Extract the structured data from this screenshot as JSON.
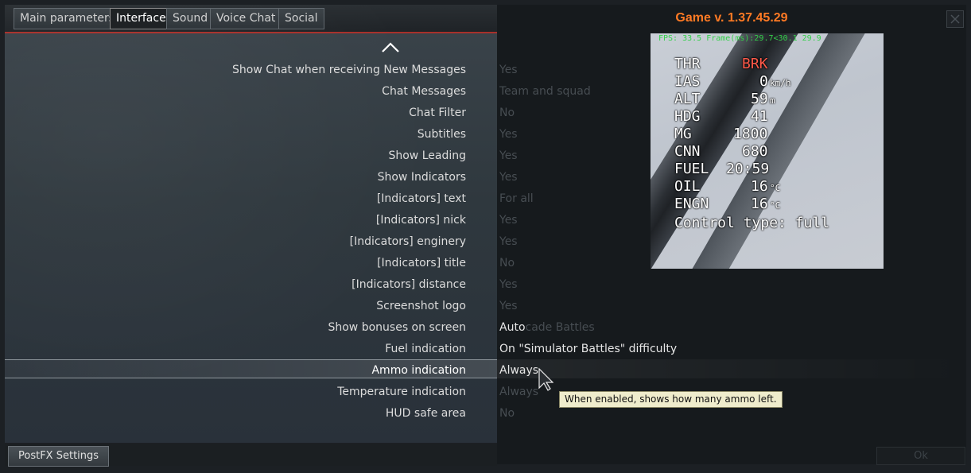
{
  "tabs": [
    {
      "label": "Main parameters"
    },
    {
      "label": "Interface"
    },
    {
      "label": "Sound"
    },
    {
      "label": "Voice Chat"
    },
    {
      "label": "Social"
    }
  ],
  "version": "Game v. 1.37.45.29",
  "settings": [
    {
      "label": "Show Chat when receiving New Messages",
      "value": "Yes"
    },
    {
      "label": "Chat Messages",
      "value": "Team and squad"
    },
    {
      "label": "Chat Filter",
      "value": "No"
    },
    {
      "label": "Subtitles",
      "value": "Yes"
    },
    {
      "label": "Show Leading",
      "value": "Yes"
    },
    {
      "label": "Show Indicators",
      "value": "Yes"
    },
    {
      "label": "[Indicators] text",
      "value": "For all"
    },
    {
      "label": "[Indicators] nick",
      "value": "Yes"
    },
    {
      "label": "[Indicators] enginery",
      "value": "Yes"
    },
    {
      "label": "[Indicators] title",
      "value": "No"
    },
    {
      "label": "[Indicators] distance",
      "value": "Yes"
    },
    {
      "label": "Screenshot logo",
      "value": "Yes"
    },
    {
      "label": "Show bonuses on screen",
      "value": "Auto",
      "value_ghost": "cade Battles"
    },
    {
      "label": "Fuel indication",
      "value": "On \"Simulator Battles\" difficulty"
    },
    {
      "label": "Ammo indication",
      "value": "Always"
    },
    {
      "label": "Temperature indication",
      "value": "Always"
    },
    {
      "label": "HUD safe area",
      "value": "No"
    }
  ],
  "tooltip": "When enabled, shows how many ammo left.",
  "preview": {
    "fps": "FPS: 33.5 Frame(ms):29.7<30.1 29.9",
    "hud": [
      {
        "label": "THR",
        "value": "BRK",
        "unit": ""
      },
      {
        "label": "IAS",
        "value": "0",
        "unit": "km/h"
      },
      {
        "label": "ALT",
        "value": "59",
        "unit": "m"
      },
      {
        "label": "HDG",
        "value": "41",
        "unit": ""
      },
      {
        "label": "MG",
        "value": "1800",
        "unit": ""
      },
      {
        "label": "CNN",
        "value": "680",
        "unit": ""
      },
      {
        "label": "FUEL",
        "value": "20:59",
        "unit": ""
      },
      {
        "label": "OIL",
        "value": "16",
        "unit": "°C"
      },
      {
        "label": "ENGN",
        "value": "16",
        "unit": "°C"
      }
    ],
    "control_type": "Control type: full"
  },
  "buttons": {
    "postfx": "PostFX Settings",
    "ok": "Ok"
  },
  "colors": {
    "accent_red": "#a8302a",
    "version_orange": "#ff7a24",
    "fps_green": "#34d04a",
    "brk_red": "#ff5a4a"
  }
}
